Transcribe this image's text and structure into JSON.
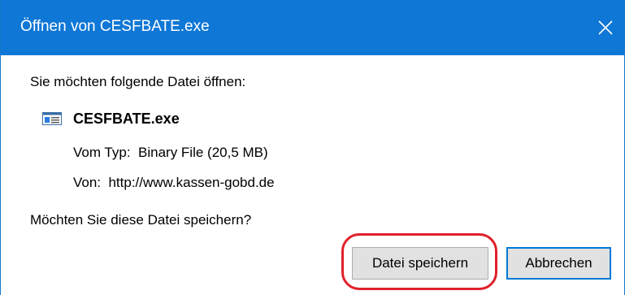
{
  "window": {
    "title": "Öffnen von CESFBATE.exe",
    "close_icon": "close-icon"
  },
  "dialog": {
    "prompt": "Sie möchten folgende Datei öffnen:",
    "file": {
      "icon": "application-file-icon",
      "name": "CESFBATE.exe"
    },
    "type_line": "Vom Typ:  Binary File (20,5 MB)",
    "from_line": "Von:  http://www.kassen-gobd.de",
    "save_prompt": "Möchten Sie diese Datei speichern?"
  },
  "buttons": {
    "save_label": "Datei speichern",
    "cancel_label": "Abbrechen"
  },
  "colors": {
    "titlebar": "#0f77d6",
    "highlight_ring": "#e0202a",
    "default_button_border": "#0078d7"
  }
}
